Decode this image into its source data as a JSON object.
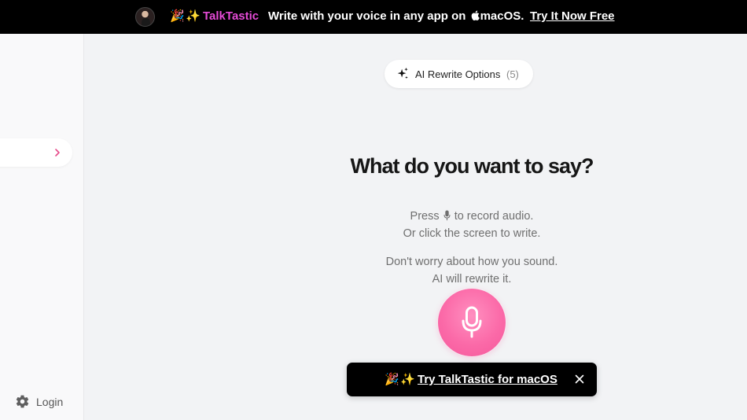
{
  "banner": {
    "emoji_1": "🎉",
    "emoji_2": "✨",
    "brand": "TalkTastic",
    "text_prefix": "Write with your voice in any app on ",
    "text_suffix": "macOS.",
    "cta": "Try It Now Free"
  },
  "sidebar": {
    "login_label": "Login"
  },
  "ai_options": {
    "label": "AI Rewrite Options",
    "count": "(5)"
  },
  "main": {
    "title": "What do you want to say?",
    "line1_before": "Press",
    "line1_after": "to record audio.",
    "line2": "Or click the screen to write.",
    "line3": "Don't worry about how you sound.",
    "line4": "AI will rewrite it."
  },
  "toast": {
    "emoji_1": "🎉",
    "emoji_2": "✨",
    "link": "Try TalkTastic for macOS"
  },
  "colors": {
    "brand_pink": "#e64bd7",
    "record_pink": "#fb6aa8",
    "banner_bg": "#000000",
    "page_bg": "#f2f3f5"
  },
  "icons": {
    "avatar": "user-avatar",
    "apple": "apple-icon",
    "chevron": "chevron-right-icon",
    "sparkle": "sparkle-icon",
    "gear": "gear-icon",
    "mic": "microphone-icon",
    "close": "close-icon"
  }
}
